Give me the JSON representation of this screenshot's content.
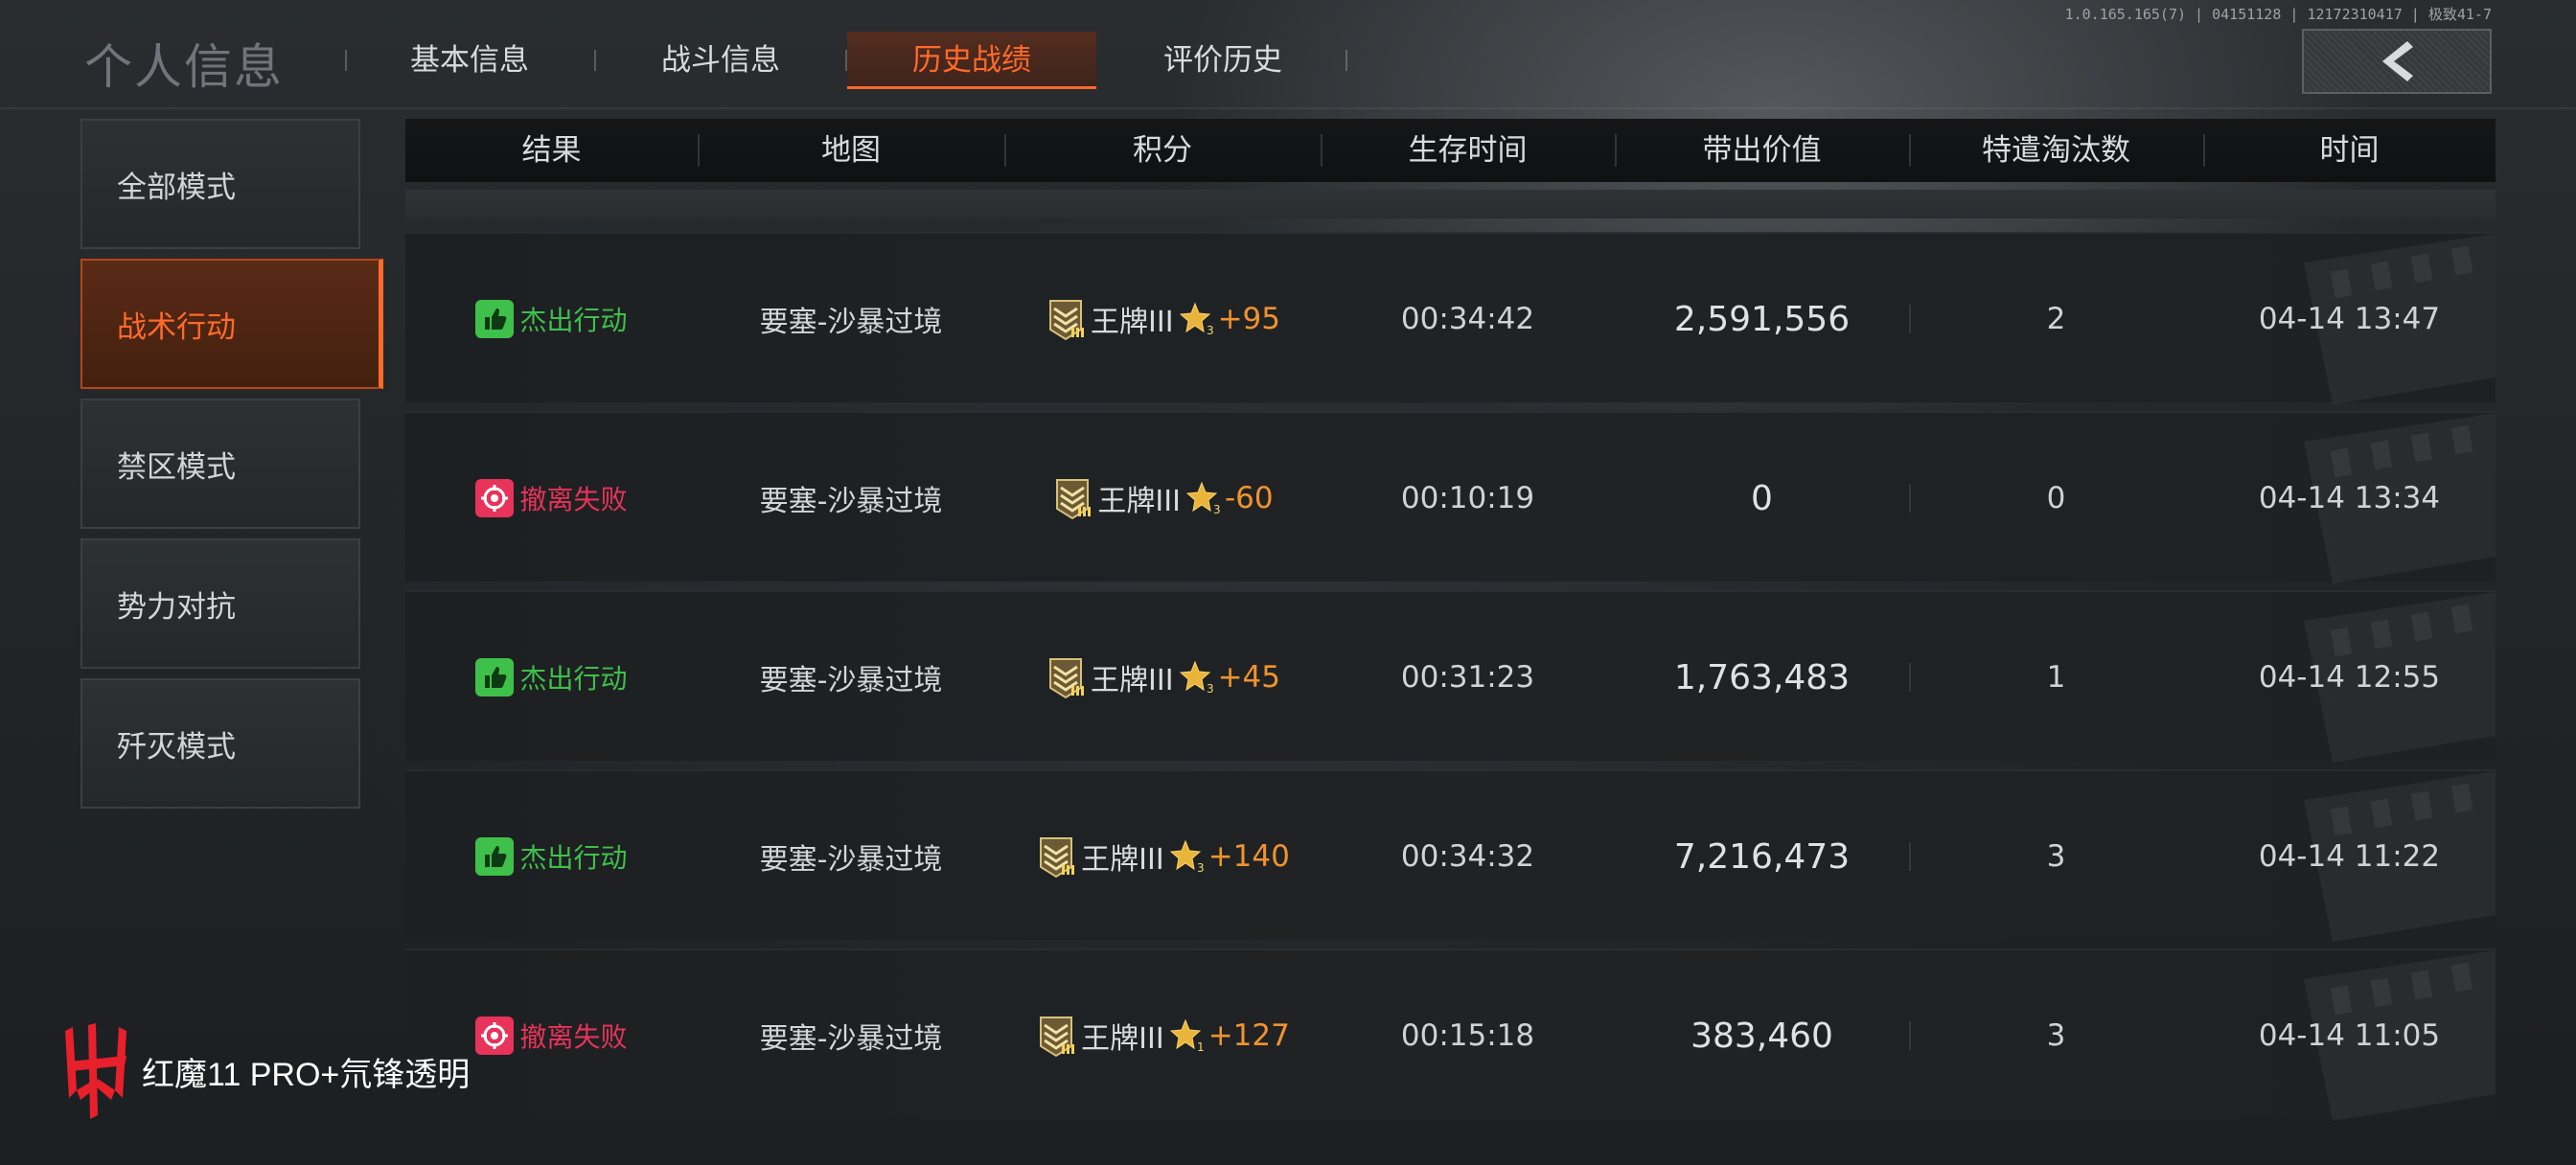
{
  "page": {
    "title": "个人信息",
    "version": "1.0.165.165(7) | 04151128 | 12172310417 | 极致41-7"
  },
  "tabs": [
    {
      "label": "基本信息",
      "active": false
    },
    {
      "label": "战斗信息",
      "active": false
    },
    {
      "label": "历史战绩",
      "active": true
    },
    {
      "label": "评价历史",
      "active": false
    }
  ],
  "sidebar": [
    {
      "label": "全部模式",
      "active": false
    },
    {
      "label": "战术行动",
      "active": true
    },
    {
      "label": "禁区模式",
      "active": false
    },
    {
      "label": "势力对抗",
      "active": false
    },
    {
      "label": "歼灭模式",
      "active": false
    }
  ],
  "columns": [
    "结果",
    "地图",
    "积分",
    "生存时间",
    "带出价值",
    "特遣淘汰数",
    "时间"
  ],
  "rows": [
    {
      "result": "杰出行动",
      "result_type": "success",
      "map": "要塞-沙暴过境",
      "rank": "王牌III",
      "star_level": "3",
      "score_delta": "+95",
      "survival": "00:34:42",
      "value": "2,591,556",
      "eliminations": "2",
      "time": "04-14 13:47"
    },
    {
      "result": "撤离失败",
      "result_type": "fail",
      "map": "要塞-沙暴过境",
      "rank": "王牌III",
      "star_level": "3",
      "score_delta": "-60",
      "survival": "00:10:19",
      "value": "0",
      "eliminations": "0",
      "time": "04-14 13:34"
    },
    {
      "result": "杰出行动",
      "result_type": "success",
      "map": "要塞-沙暴过境",
      "rank": "王牌III",
      "star_level": "3",
      "score_delta": "+45",
      "survival": "00:31:23",
      "value": "1,763,483",
      "eliminations": "1",
      "time": "04-14 12:55"
    },
    {
      "result": "杰出行动",
      "result_type": "success",
      "map": "要塞-沙暴过境",
      "rank": "王牌III",
      "star_level": "3",
      "score_delta": "+140",
      "survival": "00:34:32",
      "value": "7,216,473",
      "eliminations": "3",
      "time": "04-14 11:22"
    },
    {
      "result": "撤离失败",
      "result_type": "fail",
      "map": "要塞-沙暴过境",
      "rank": "王牌III",
      "star_level": "1",
      "score_delta": "+127",
      "survival": "00:15:18",
      "value": "383,460",
      "eliminations": "3",
      "time": "04-14 11:05"
    }
  ],
  "colors": {
    "accent": "#ff6a2a",
    "success": "#3ec04a",
    "fail": "#e8335a",
    "delta": "#f0932e"
  },
  "icons": {
    "success": "thumbs-up-icon",
    "fail": "target-icon",
    "rank": "rank-badge-icon",
    "star": "star-icon",
    "back": "back-arrow-icon",
    "brand": "red-magic-logo-icon"
  },
  "watermark": {
    "text": "红魔11 PRO+氘锋透明"
  }
}
